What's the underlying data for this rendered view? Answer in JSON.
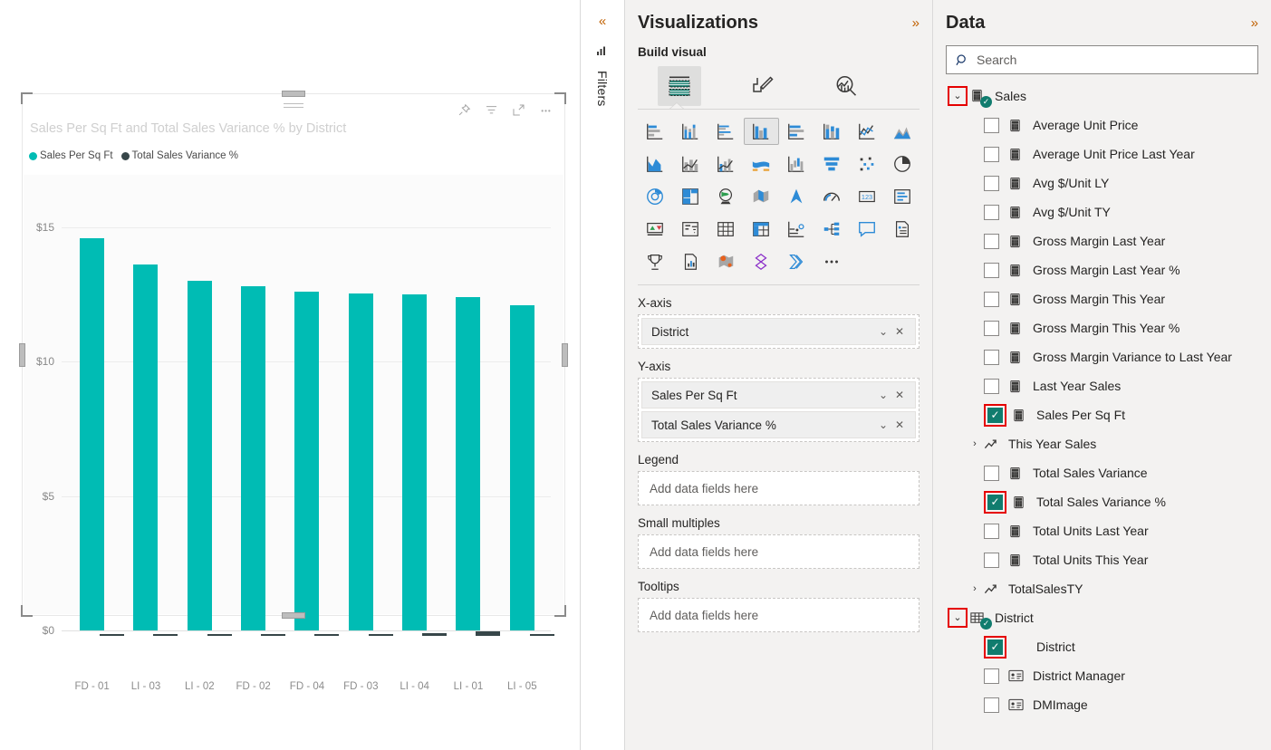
{
  "canvas": {
    "visual": {
      "title": "Sales Per Sq Ft and Total Sales Variance % by District",
      "header_icons": [
        "pin-icon",
        "filter-icon",
        "focus-mode-icon",
        "more-options-icon"
      ]
    }
  },
  "chart_data": {
    "type": "bar",
    "title": "Sales Per Sq Ft and Total Sales Variance % by District",
    "xlabel": "District",
    "ylabel": "",
    "categories": [
      "FD - 01",
      "LI - 03",
      "LI - 02",
      "FD - 02",
      "FD - 04",
      "FD - 03",
      "LI - 04",
      "LI - 01",
      "LI - 05"
    ],
    "ytick_labels": [
      "$15",
      "$10",
      "$5",
      "$0"
    ],
    "ytick_values": [
      15,
      10,
      5,
      0
    ],
    "ylim": [
      0,
      15.6
    ],
    "grid": true,
    "legend_position": "top-left",
    "series": [
      {
        "name": "Sales Per Sq Ft",
        "color": "#00BCB4",
        "values": [
          14.6,
          13.6,
          13.0,
          12.8,
          12.6,
          12.55,
          12.5,
          12.4,
          12.1
        ]
      },
      {
        "name": "Total Sales Variance %",
        "color": "#374649",
        "values": [
          -0.05,
          -0.05,
          -0.06,
          -0.06,
          -0.07,
          -0.07,
          -0.1,
          -0.18,
          -0.05
        ]
      }
    ]
  },
  "filters_rail": {
    "collapse_label": "«",
    "label": "Filters"
  },
  "visualizations": {
    "title": "Visualizations",
    "expand_label": "»",
    "subtitle": "Build visual",
    "build_tabs": [
      {
        "name": "build-visual-tab",
        "icon": "build-fields-icon",
        "selected": true
      },
      {
        "name": "format-visual-tab",
        "icon": "format-paintbrush-icon",
        "selected": false
      },
      {
        "name": "analytics-tab",
        "icon": "analytics-magnifier-icon",
        "selected": false
      }
    ],
    "visual_types": [
      {
        "icon": "stacked-bar-chart-icon",
        "selected": false
      },
      {
        "icon": "stacked-column-chart-icon",
        "selected": false
      },
      {
        "icon": "clustered-bar-chart-icon",
        "selected": false
      },
      {
        "icon": "clustered-column-chart-icon",
        "selected": true
      },
      {
        "icon": "100-percent-stacked-bar-chart-icon",
        "selected": false
      },
      {
        "icon": "100-percent-stacked-column-chart-icon",
        "selected": false
      },
      {
        "icon": "line-chart-icon",
        "selected": false
      },
      {
        "icon": "area-chart-icon",
        "selected": false
      },
      {
        "icon": "stacked-area-chart-icon",
        "selected": false
      },
      {
        "icon": "line-and-stacked-column-chart-icon",
        "selected": false
      },
      {
        "icon": "line-and-clustered-column-chart-icon",
        "selected": false
      },
      {
        "icon": "ribbon-chart-icon",
        "selected": false
      },
      {
        "icon": "waterfall-chart-icon",
        "selected": false
      },
      {
        "icon": "funnel-chart-icon",
        "selected": false
      },
      {
        "icon": "scatter-chart-icon",
        "selected": false
      },
      {
        "icon": "pie-chart-icon",
        "selected": false
      },
      {
        "icon": "donut-chart-icon",
        "selected": false
      },
      {
        "icon": "treemap-icon",
        "selected": false
      },
      {
        "icon": "map-icon",
        "selected": false
      },
      {
        "icon": "filled-map-icon",
        "selected": false
      },
      {
        "icon": "azure-map-icon",
        "selected": false
      },
      {
        "icon": "gauge-icon",
        "selected": false
      },
      {
        "icon": "card-icon",
        "selected": false
      },
      {
        "icon": "multi-row-card-icon",
        "selected": false
      },
      {
        "icon": "kpi-icon",
        "selected": false
      },
      {
        "icon": "slicer-icon",
        "selected": false
      },
      {
        "icon": "table-icon",
        "selected": false
      },
      {
        "icon": "matrix-icon",
        "selected": false
      },
      {
        "icon": "r-script-visual-icon",
        "selected": false
      },
      {
        "icon": "decomposition-tree-icon",
        "selected": false
      },
      {
        "icon": "smart-narrative-icon",
        "selected": false
      },
      {
        "icon": "paginated-report-icon",
        "selected": false
      },
      {
        "icon": "key-influencers-icon",
        "selected": false
      },
      {
        "icon": "python-visual-icon",
        "selected": false
      },
      {
        "icon": "arcgis-map-icon",
        "selected": false
      },
      {
        "icon": "powerapps-icon",
        "selected": false
      },
      {
        "icon": "power-automate-icon",
        "selected": false
      },
      {
        "icon": "more-visuals-icon",
        "selected": false
      }
    ],
    "wells": [
      {
        "label": "X-axis",
        "placeholder": "",
        "fields": [
          {
            "name": "District"
          }
        ]
      },
      {
        "label": "Y-axis",
        "placeholder": "",
        "fields": [
          {
            "name": "Sales Per Sq Ft"
          },
          {
            "name": "Total Sales Variance %"
          }
        ]
      },
      {
        "label": "Legend",
        "placeholder": "Add data fields here",
        "fields": []
      },
      {
        "label": "Small multiples",
        "placeholder": "Add data fields here",
        "fields": []
      },
      {
        "label": "Tooltips",
        "placeholder": "Add data fields here",
        "fields": []
      }
    ]
  },
  "data_pane": {
    "title": "Data",
    "expand_label": "»",
    "search": {
      "placeholder": "Search",
      "value": "",
      "icon": "search-icon"
    },
    "tree": [
      {
        "kind": "table",
        "label": "Sales",
        "expanded": true,
        "chevron": "∨",
        "chevron_highlighted": true,
        "icon": "measure-table-icon",
        "badge": "✓"
      },
      {
        "kind": "field",
        "label": "Average Unit Price",
        "checked": false,
        "icon": "measure-icon"
      },
      {
        "kind": "field",
        "label": "Average Unit Price Last Year",
        "checked": false,
        "icon": "measure-icon"
      },
      {
        "kind": "field",
        "label": "Avg $/Unit LY",
        "checked": false,
        "icon": "measure-icon"
      },
      {
        "kind": "field",
        "label": "Avg $/Unit TY",
        "checked": false,
        "icon": "measure-icon"
      },
      {
        "kind": "field",
        "label": "Gross Margin Last Year",
        "checked": false,
        "icon": "measure-icon"
      },
      {
        "kind": "field",
        "label": "Gross Margin Last Year %",
        "checked": false,
        "icon": "measure-icon"
      },
      {
        "kind": "field",
        "label": "Gross Margin This Year",
        "checked": false,
        "icon": "measure-icon"
      },
      {
        "kind": "field",
        "label": "Gross Margin This Year %",
        "checked": false,
        "icon": "measure-icon"
      },
      {
        "kind": "field",
        "label": "Gross Margin Variance to Last Year",
        "checked": false,
        "icon": "measure-icon"
      },
      {
        "kind": "field",
        "label": "Last Year Sales",
        "checked": false,
        "icon": "measure-icon"
      },
      {
        "kind": "field",
        "label": "Sales Per Sq Ft",
        "checked": true,
        "checkbox_highlighted": true,
        "icon": "measure-icon"
      },
      {
        "kind": "folder",
        "label": "This Year Sales",
        "chevron": "›",
        "icon": "trend-arrow-icon"
      },
      {
        "kind": "field",
        "label": "Total Sales Variance",
        "checked": false,
        "icon": "measure-icon"
      },
      {
        "kind": "field",
        "label": "Total Sales Variance %",
        "checked": true,
        "checkbox_highlighted": true,
        "icon": "measure-icon"
      },
      {
        "kind": "field",
        "label": "Total Units Last Year",
        "checked": false,
        "icon": "measure-icon"
      },
      {
        "kind": "field",
        "label": "Total Units This Year",
        "checked": false,
        "icon": "measure-icon"
      },
      {
        "kind": "folder",
        "label": "TotalSalesTY",
        "chevron": "›",
        "icon": "trend-arrow-icon"
      },
      {
        "kind": "table",
        "label": "District",
        "expanded": true,
        "chevron": "∨",
        "chevron_highlighted": true,
        "icon": "table-grid-icon",
        "badge": "✓"
      },
      {
        "kind": "field",
        "label": "District",
        "checked": true,
        "checkbox_highlighted": true,
        "icon": "none"
      },
      {
        "kind": "field",
        "label": "District Manager",
        "checked": false,
        "icon": "text-field-icon"
      },
      {
        "kind": "field",
        "label": "DMImage",
        "checked": false,
        "icon": "text-field-icon"
      }
    ]
  },
  "colors": {
    "series_primary": "#00BCB4",
    "series_secondary": "#374649",
    "accent_orange": "#C06000",
    "check_green": "#107C6E",
    "highlight_red": "#E50000"
  }
}
